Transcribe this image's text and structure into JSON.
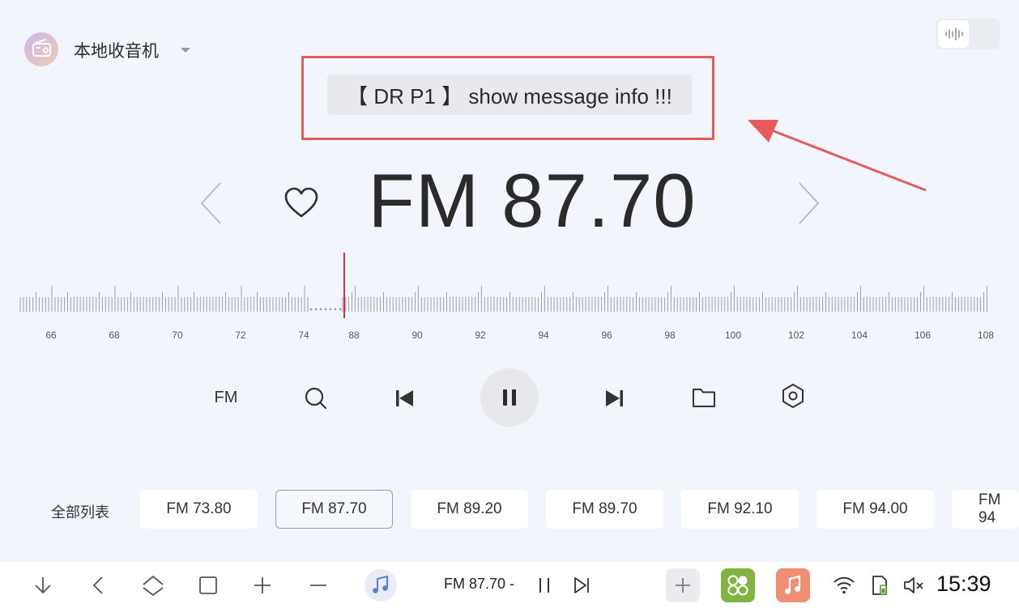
{
  "header": {
    "app_title": "本地收音机"
  },
  "message": {
    "text": "【 DR P1 】 show message info !!!"
  },
  "tuner": {
    "frequency": "FM 87.70"
  },
  "scale": {
    "labels": [
      "66",
      "68",
      "70",
      "72",
      "74",
      "88",
      "90",
      "92",
      "94",
      "96",
      "98",
      "100",
      "102",
      "104",
      "106",
      "108"
    ]
  },
  "controls": {
    "band_label": "FM"
  },
  "presets": {
    "all_list_label": "全部列表",
    "items": [
      "FM 73.80",
      "FM 87.70",
      "FM 89.20",
      "FM 89.70",
      "FM 92.10",
      "FM 94.00",
      "FM 94"
    ],
    "active_index": 1
  },
  "bottombar": {
    "now_playing": "FM 87.70 -",
    "clock": "15:39"
  },
  "colors": {
    "accent_red": "#d6303a",
    "annotation_red": "#e65a5a",
    "background": "#f2f6fc"
  }
}
